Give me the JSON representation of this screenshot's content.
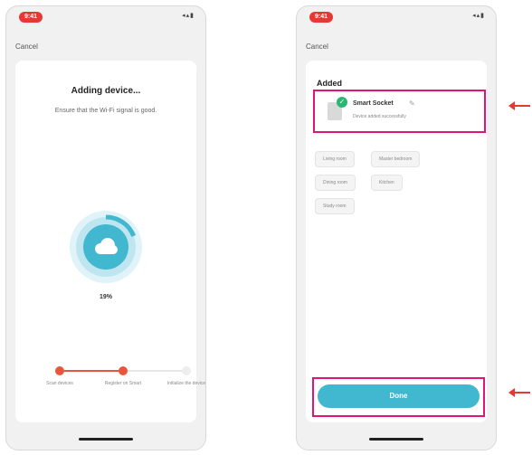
{
  "left_screen": {
    "status_time": "9:41",
    "status_icons": "◂▴▮",
    "cancel_label": "Cancel",
    "title": "Adding device...",
    "subtitle": "Ensure that the Wi-Fi signal is good.",
    "progress_percent": 19,
    "progress_label": "19%",
    "steps": [
      {
        "label": "Scan devices",
        "state": "done"
      },
      {
        "label": "Register on Smart",
        "state": "done"
      },
      {
        "label": "Initialize the device",
        "state": "pending"
      }
    ]
  },
  "right_screen": {
    "status_time": "9:41",
    "status_icons": "◂▴▮",
    "cancel_label": "Cancel",
    "added_title": "Added",
    "device": {
      "name": "Smart Socket",
      "status": "Device added successfully"
    },
    "rooms": [
      "Living room",
      "Master bedroom",
      "Dining room",
      "Kitchen",
      "Study room"
    ],
    "done_label": "Done"
  },
  "colors": {
    "accent": "#41b8cf",
    "highlight": "#e0157a",
    "step_active": "#e8553d",
    "arrow": "#e53935",
    "success": "#2bb673"
  }
}
